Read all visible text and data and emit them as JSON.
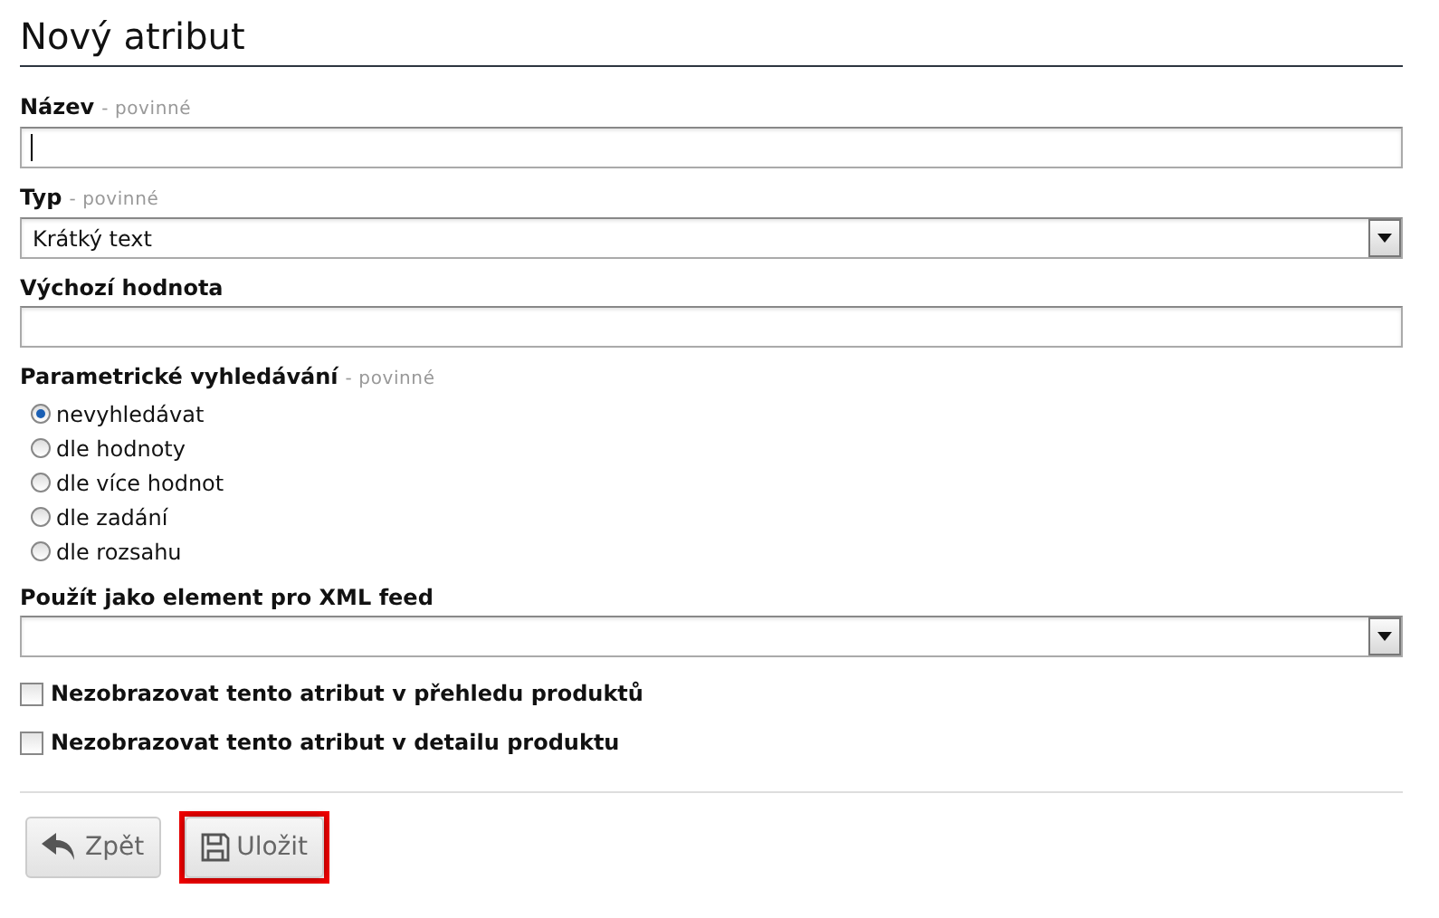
{
  "title": "Nový atribut",
  "fields": [
    {
      "kind": "text",
      "label": "Název",
      "note": "- povinné",
      "focused": true
    },
    {
      "kind": "select",
      "label": "Typ",
      "note": "- povinné",
      "value": "Krátký text"
    },
    {
      "kind": "text",
      "label": "Výchozí hodnota",
      "focused": false
    },
    {
      "kind": "radio",
      "label": "Parametrické vyhledávání",
      "note": "- povinné",
      "options": [
        {
          "label": "nevyhledávat",
          "selected": true
        },
        {
          "label": "dle hodnoty",
          "selected": false
        },
        {
          "label": "dle více hodnot",
          "selected": false
        },
        {
          "label": "dle zadání",
          "selected": false
        },
        {
          "label": "dle rozsahu",
          "selected": false
        }
      ]
    },
    {
      "kind": "select",
      "label": "Použít jako element pro XML feed"
    },
    {
      "kind": "checkbox",
      "label": "Nezobrazovat tento atribut v přehledu produktů",
      "checked": false
    },
    {
      "kind": "checkbox",
      "label": "Nezobrazovat tento atribut v detailu produktu",
      "checked": false
    }
  ],
  "buttons": [
    {
      "kind": "back",
      "label": "Zpět",
      "highlighted": false
    },
    {
      "kind": "save",
      "label": "Uložit",
      "highlighted": true
    }
  ]
}
